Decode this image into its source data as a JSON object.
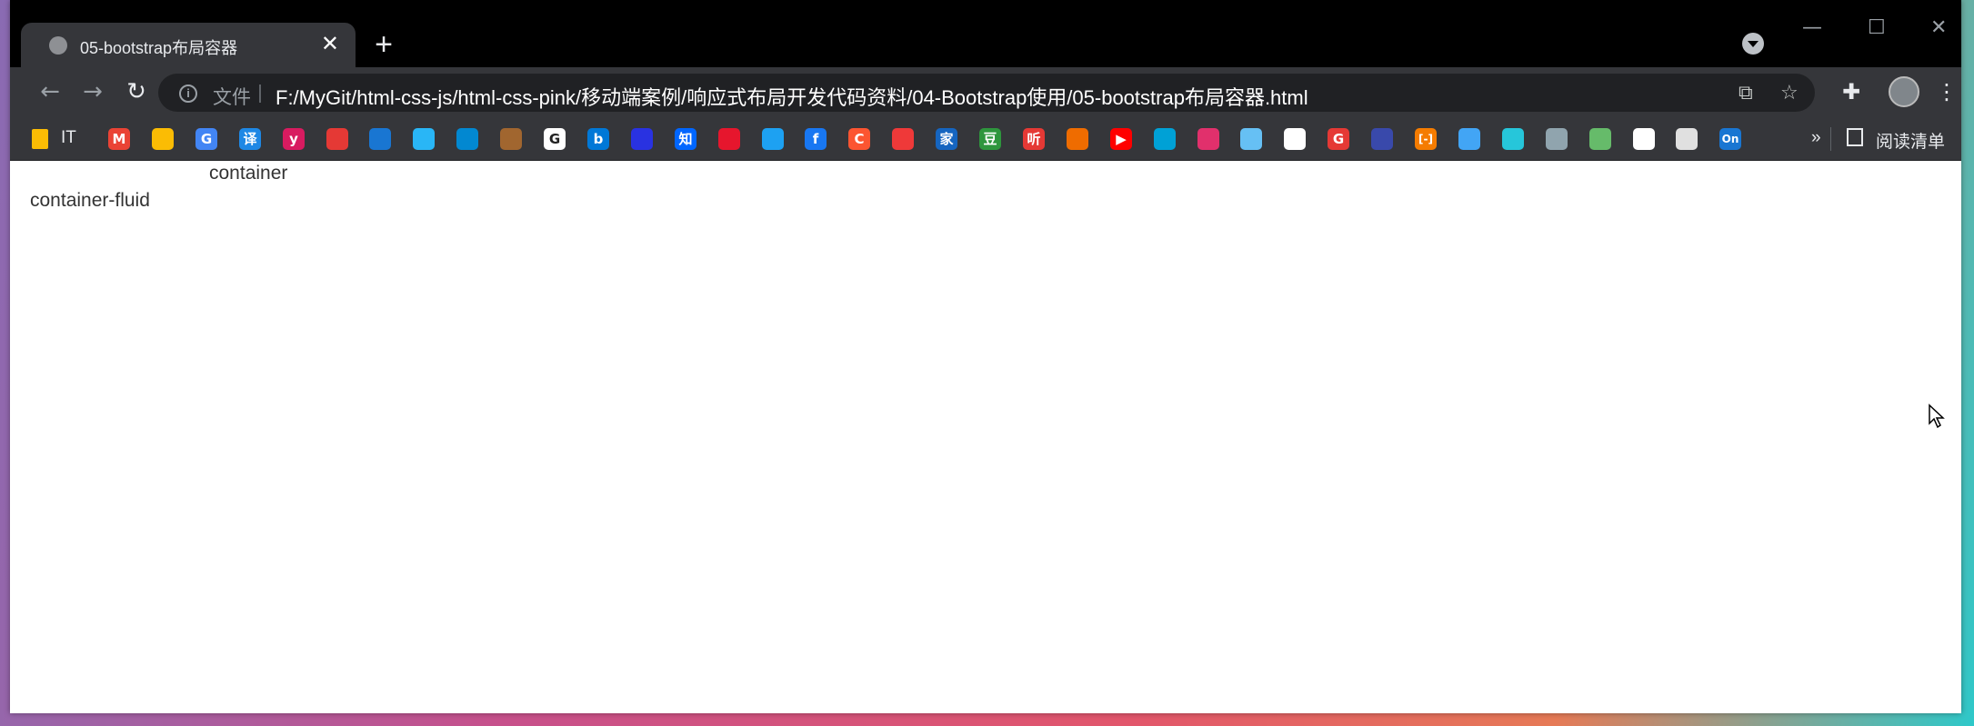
{
  "tab": {
    "title": "05-bootstrap布局容器",
    "close": "✕",
    "new": "+"
  },
  "window_controls": {
    "minimize": "—",
    "maximize": "☐",
    "close": "✕"
  },
  "toolbar": {
    "back": "←",
    "forward": "→",
    "reload": "↻",
    "scheme_label": "文件",
    "url": "F:/MyGit/html-css-js/html-css-pink/移动端案例/响应式布局开发代码资料/04-Bootstrap使用/05-bootstrap布局容器.html",
    "translate_icon": "translate-icon",
    "star": "☆",
    "extensions": "extensions-icon",
    "menu": "⋮"
  },
  "bookmarks": {
    "folder_label": "IT",
    "items": [
      {
        "name": "gmail",
        "color": "#ea4335",
        "glyph": "M"
      },
      {
        "name": "chrome",
        "color": "#fbbc04",
        "glyph": ""
      },
      {
        "name": "google-translate",
        "color": "#4285f4",
        "glyph": "G"
      },
      {
        "name": "youdao-translate",
        "color": "#1e88e5",
        "glyph": "译"
      },
      {
        "name": "yuque",
        "color": "#d81b60",
        "glyph": "y"
      },
      {
        "name": "maps",
        "color": "#e53935",
        "glyph": ""
      },
      {
        "name": "globe",
        "color": "#1976d2",
        "glyph": ""
      },
      {
        "name": "baidu-netdisk",
        "color": "#29b6f6",
        "glyph": ""
      },
      {
        "name": "cloud",
        "color": "#0288d1",
        "glyph": ""
      },
      {
        "name": "acorn",
        "color": "#a1662f",
        "glyph": ""
      },
      {
        "name": "google",
        "color": "#ffffff",
        "glyph": "G"
      },
      {
        "name": "bing",
        "color": "#0078d7",
        "glyph": "b"
      },
      {
        "name": "baidu",
        "color": "#2932e1",
        "glyph": ""
      },
      {
        "name": "zhihu",
        "color": "#0066ff",
        "glyph": "知"
      },
      {
        "name": "weibo",
        "color": "#e6162d",
        "glyph": ""
      },
      {
        "name": "twitter",
        "color": "#1da1f2",
        "glyph": ""
      },
      {
        "name": "facebook",
        "color": "#1877f2",
        "glyph": "f"
      },
      {
        "name": "csdn",
        "color": "#fc5531",
        "glyph": "C"
      },
      {
        "name": "vivaldi",
        "color": "#ef3939",
        "glyph": ""
      },
      {
        "name": "jia",
        "color": "#1565c0",
        "glyph": "家"
      },
      {
        "name": "douban",
        "color": "#2e963d",
        "glyph": "豆"
      },
      {
        "name": "ting",
        "color": "#e53935",
        "glyph": "听"
      },
      {
        "name": "face",
        "color": "#ef6c00",
        "glyph": ""
      },
      {
        "name": "youtube",
        "color": "#ff0000",
        "glyph": "▶"
      },
      {
        "name": "bilibili",
        "color": "#00a1d6",
        "glyph": ""
      },
      {
        "name": "instagram",
        "color": "#e1306c",
        "glyph": ""
      },
      {
        "name": "steam",
        "color": "#66c0f4",
        "glyph": ""
      },
      {
        "name": "github",
        "color": "#ffffff",
        "glyph": ""
      },
      {
        "name": "g-red",
        "color": "#e53935",
        "glyph": "G"
      },
      {
        "name": "dark-globe",
        "color": "#3949ab",
        "glyph": ""
      },
      {
        "name": "bracket",
        "color": "#f57c00",
        "glyph": "[-]"
      },
      {
        "name": "cloud-outline",
        "color": "#42a5f5",
        "glyph": ""
      },
      {
        "name": "bird",
        "color": "#26c6da",
        "glyph": ""
      },
      {
        "name": "rocket",
        "color": "#90a4ae",
        "glyph": ""
      },
      {
        "name": "hat",
        "color": "#66bb6a",
        "glyph": ""
      },
      {
        "name": "codepen",
        "color": "#ffffff",
        "glyph": ""
      },
      {
        "name": "box",
        "color": "#e0e0e0",
        "glyph": ""
      },
      {
        "name": "on",
        "color": "#1976d2",
        "glyph": "On"
      }
    ],
    "overflow": "»",
    "reading_list_label": "阅读清单"
  },
  "page": {
    "container_text": "container",
    "container_fluid_text": "container-fluid"
  }
}
